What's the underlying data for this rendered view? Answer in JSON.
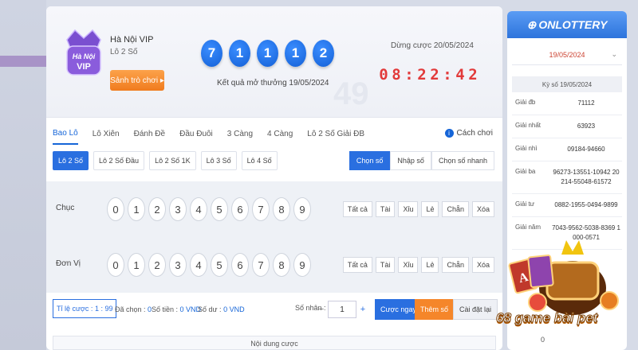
{
  "game": {
    "name": "Hà Nội VIP",
    "type": "Lô 2 Số",
    "play_button": "Sảnh trò chơi ▸",
    "logo_text": "Hà Nội VIP"
  },
  "result": {
    "balls": [
      "7",
      "1",
      "1",
      "1",
      "2"
    ],
    "caption": "Kết quả mở thưởng 19/05/2024"
  },
  "countdown": {
    "label": "Dừng cược 20/05/2024",
    "digits": [
      "0",
      "8",
      ":",
      "2",
      "2",
      ":",
      "4",
      "2"
    ]
  },
  "tabs": [
    "Bao Lô",
    "Lô Xiên",
    "Đánh Đề",
    "Đầu Đuôi",
    "3 Càng",
    "4 Càng",
    "Lô 2 Số Giải ĐB"
  ],
  "guide_label": "Cách chơi",
  "subtabs": [
    "Lô 2 Số",
    "Lô 2 Số Đầu",
    "Lô 2 Số 1K",
    "Lô 3 Số",
    "Lô 4 Số"
  ],
  "modes": [
    "Chọn số",
    "Nhập số",
    "Chọn số nhanh"
  ],
  "rows": [
    {
      "label": "Chục"
    },
    {
      "label": "Đơn Vị"
    }
  ],
  "digits": [
    "0",
    "1",
    "2",
    "3",
    "4",
    "5",
    "6",
    "7",
    "8",
    "9"
  ],
  "quick_picks": [
    "Tất cả",
    "Tài",
    "Xỉu",
    "Lẻ",
    "Chẵn",
    "Xóa"
  ],
  "footer": {
    "ratio_label": "Tỉ lệ cược :",
    "ratio_value": "1 : 99",
    "selected_label": "Đã chọn :",
    "selected_value": "0",
    "money_label": "Số tiền :",
    "money_value": "0 VND",
    "balance_label": "Số dư :",
    "balance_value": "0 VND",
    "multiplier_label": "Số nhân :",
    "multiplier_value": "1",
    "minus": "−",
    "plus": "+",
    "bet_now": "Cược ngay",
    "add_number": "Thêm số",
    "reset": "Cài đặt lại",
    "content_label": "Nội dung cược"
  },
  "sidebar": {
    "brand": "ONLOTTERY",
    "date": "19/05/2024",
    "draw_label": "Kỳ số 19/05/2024",
    "prizes": [
      {
        "name": "Giải đb",
        "value": "71112"
      },
      {
        "name": "Giải nhất",
        "value": "63923"
      },
      {
        "name": "Giải nhì",
        "value": "09184-94660"
      },
      {
        "name": "Giải ba",
        "value": "96273-13551-10942 20214-55048-61572"
      },
      {
        "name": "Giải tư",
        "value": "0882-1955-0494-9899"
      },
      {
        "name": "Giải năm",
        "value": "7043-9562-5038-8369 1000-0571"
      }
    ],
    "zero": "0"
  },
  "promo": {
    "text": "68 game bài pet"
  },
  "colors": {
    "accent": "#1565d8",
    "orange": "#f07b1e",
    "countdown": "#e23a3a"
  }
}
